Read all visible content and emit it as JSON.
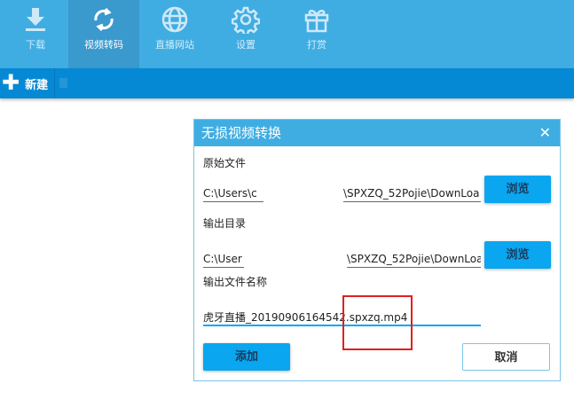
{
  "nav": {
    "tabs": [
      {
        "label": "下载",
        "icon": "download-icon"
      },
      {
        "label": "视频转码",
        "icon": "refresh-icon",
        "active": true
      },
      {
        "label": "直播网站",
        "icon": "globe-icon"
      },
      {
        "label": "设置",
        "icon": "gear-icon"
      },
      {
        "label": "打赏",
        "icon": "gift-icon"
      }
    ]
  },
  "toolbar": {
    "new_label": "新建"
  },
  "dialog": {
    "title": "无损视频转换",
    "close": "✕",
    "source_label": "原始文件",
    "source_value_start": "C:\\Users\\c",
    "source_value_end": "\\SPXZQ_52Pojie\\DownLoa",
    "output_dir_label": "输出目录",
    "output_dir_start": "C:\\User",
    "output_dir_end": "\\SPXZQ_52Pojie\\DownLoa",
    "browse_label": "浏览",
    "output_name_label": "输出文件名称",
    "output_name_value": "虎牙直播_20190906164542.spxzq.mp4",
    "add_label": "添加",
    "cancel_label": "取消"
  }
}
